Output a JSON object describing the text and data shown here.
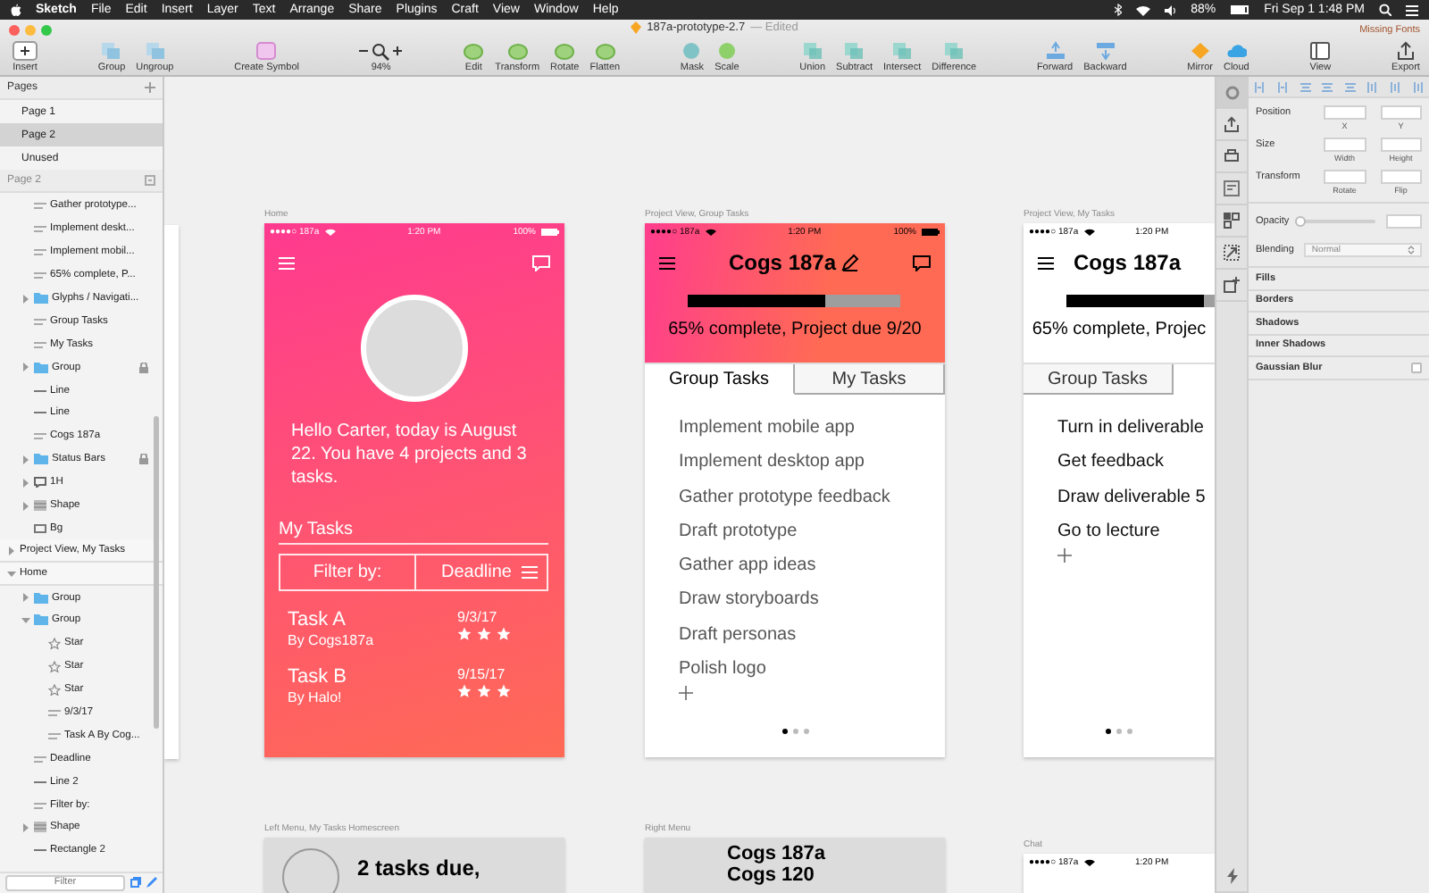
{
  "menubar": {
    "app": "Sketch",
    "menus": [
      "File",
      "Edit",
      "Insert",
      "Layer",
      "Text",
      "Arrange",
      "Share",
      "Plugins",
      "Craft",
      "View",
      "Window",
      "Help"
    ],
    "battery": "88%",
    "clock": "Fri Sep 1 1:48 PM"
  },
  "toolbar": {
    "document": "187a-prototype-2.7",
    "edited": "— Edited",
    "warning": "Missing Fonts",
    "groups": [
      {
        "kind": "insert",
        "tools": [
          "Insert"
        ]
      },
      {
        "kind": "arrange",
        "tools": [
          "Group",
          "Ungroup"
        ]
      },
      {
        "kind": "symbol",
        "tools": [
          "Create Symbol"
        ]
      },
      {
        "kind": "zoom",
        "tools": [
          "94%"
        ]
      },
      {
        "kind": "path",
        "tools": [
          "Edit",
          "Transform",
          "Rotate",
          "Flatten"
        ]
      },
      {
        "kind": "mask",
        "tools": [
          "Mask",
          "Scale"
        ]
      },
      {
        "kind": "boolean",
        "tools": [
          "Union",
          "Subtract",
          "Intersect",
          "Difference"
        ]
      },
      {
        "kind": "layer",
        "tools": [
          "Forward",
          "Backward"
        ]
      },
      {
        "kind": "share",
        "tools": [
          "Mirror",
          "Cloud"
        ]
      },
      {
        "kind": "view",
        "tools": [
          "View"
        ]
      },
      {
        "kind": "export",
        "tools": [
          "Export"
        ]
      }
    ]
  },
  "sidebar": {
    "pages_title": "Pages",
    "pages": [
      {
        "label": "Page 1",
        "selected": false
      },
      {
        "label": "Page 2",
        "selected": true
      },
      {
        "label": "Unused",
        "selected": false
      }
    ],
    "layers_title": "Page 2",
    "layers": [
      {
        "kind": "continued",
        "children": [
          {
            "kind": "text",
            "label": "Gather prototype..."
          },
          {
            "kind": "text",
            "label": "Implement deskt..."
          },
          {
            "kind": "text",
            "label": "Implement mobil..."
          },
          {
            "kind": "text",
            "label": "65% complete, P..."
          },
          {
            "kind": "folder",
            "label": "Glyphs / Navigati...",
            "expanded": false
          },
          {
            "kind": "text",
            "label": "Group Tasks"
          },
          {
            "kind": "text",
            "label": "My Tasks"
          },
          {
            "kind": "folder",
            "label": "Group",
            "expanded": false,
            "locked": true
          },
          {
            "kind": "line",
            "label": "Line"
          },
          {
            "kind": "line",
            "label": "Line"
          },
          {
            "kind": "text",
            "label": "Cogs 187a"
          },
          {
            "kind": "folder",
            "label": "Status Bars",
            "expanded": false,
            "locked": true
          },
          {
            "kind": "comment",
            "label": "1H",
            "expanded": false
          },
          {
            "kind": "shape",
            "label": "Shape",
            "expanded": false
          },
          {
            "kind": "rect",
            "label": "Bg"
          }
        ]
      },
      {
        "kind": "artboard",
        "label": "Project View, My Tasks",
        "expanded": false
      },
      {
        "kind": "artboard",
        "label": "Home",
        "expanded": true,
        "children": [
          {
            "kind": "folder",
            "label": "Group",
            "expanded": false
          },
          {
            "kind": "folder",
            "label": "Group",
            "expanded": true,
            "children": [
              {
                "kind": "star",
                "label": "Star"
              },
              {
                "kind": "star",
                "label": "Star"
              },
              {
                "kind": "star",
                "label": "Star"
              },
              {
                "kind": "text",
                "label": "9/3/17"
              },
              {
                "kind": "text",
                "label": "Task A By Cog..."
              }
            ]
          },
          {
            "kind": "text",
            "label": "Deadline"
          },
          {
            "kind": "line",
            "label": "Line 2"
          },
          {
            "kind": "text",
            "label": "Filter by:"
          },
          {
            "kind": "shape",
            "label": "Shape",
            "expanded": false
          },
          {
            "kind": "line",
            "label": "Rectangle 2"
          }
        ]
      }
    ],
    "filter": {
      "placeholder": "Filter"
    }
  },
  "canvas": {
    "artboards": [
      {
        "kind": "home",
        "label": "Home",
        "status": {
          "carrier": "●●●●○ 187a",
          "time": "1:20 PM",
          "battery": "100%"
        },
        "greeting": "Hello Carter, today is August 22. You have 4 projects and 3 tasks.",
        "section": "My Tasks",
        "filter_label": "Filter by:",
        "filter_value": "Deadline",
        "tasks": [
          {
            "title": "Task A",
            "by": "By Cogs187a",
            "date": "9/3/17",
            "stars": 3
          },
          {
            "title": "Task B",
            "by": "By Halo!",
            "date": "9/15/17",
            "stars": 3
          }
        ]
      },
      {
        "kind": "project",
        "banner": true,
        "label": "Project View, Group Tasks",
        "status": {
          "carrier": "●●●●○ 187a",
          "time": "1:20 PM",
          "battery": "100%"
        },
        "title": "Cogs 187a",
        "progress": {
          "level": 0.65,
          "text": "65% complete, Project due 9/20"
        },
        "tabs": [
          {
            "label": "Group Tasks",
            "selected": true
          },
          {
            "label": "My Tasks",
            "selected": false
          }
        ],
        "items": [
          "Implement mobile app",
          "Implement desktop app",
          "Gather prototype feedback",
          "Draft prototype",
          "Gather app ideas",
          "Draw storyboards",
          "Draft personas",
          "Polish logo"
        ],
        "pages": [
          {
            "selected": true
          },
          {
            "selected": false
          },
          {
            "selected": false
          }
        ]
      },
      {
        "kind": "project",
        "banner": false,
        "label": "Project View, My Tasks",
        "status": {
          "carrier": "●●●●○ 187a",
          "time": "1:20 PM"
        },
        "title": "Cogs 187a",
        "progress": {
          "level": 0.65,
          "text": "65% complete, Projec"
        },
        "tabs": [
          {
            "label": "Group Tasks",
            "selected": false
          },
          {
            "selected": true
          }
        ],
        "items": [
          "Turn in deliverable",
          "Get feedback",
          "Draw deliverable 5",
          "Go to lecture"
        ],
        "pages": [
          {
            "selected": true
          },
          {
            "selected": false
          },
          {
            "selected": false
          }
        ]
      },
      {
        "kind": "profile",
        "label": "Left Menu, My Tasks Homescreen",
        "heading": "2 tasks due,"
      },
      {
        "kind": "menu",
        "label": "Right Menu",
        "lines": [
          "Cogs 187a",
          "Cogs 120"
        ]
      },
      {
        "kind": "chat",
        "label": "Chat",
        "status": {
          "carrier": "●●●●○ 187a",
          "time": "1:20 PM"
        }
      }
    ]
  },
  "inspector": {
    "rows": [
      {
        "label": "Position",
        "captions": [
          "X",
          "Y"
        ]
      },
      {
        "label": "Size",
        "captions": [
          "Width",
          "Height"
        ]
      },
      {
        "label": "Transform",
        "captions": [
          "Rotate",
          "Flip"
        ]
      }
    ],
    "opacity": {
      "label": "Opacity",
      "level": 0
    },
    "blending": {
      "label": "Blending",
      "value": "Normal"
    },
    "sections": [
      {
        "kind": "header",
        "label": "Fills"
      },
      {
        "kind": "header",
        "label": "Borders"
      },
      {
        "kind": "header",
        "label": "Shadows"
      },
      {
        "kind": "header",
        "label": "Inner Shadows"
      },
      {
        "kind": "toggle",
        "label": "Gaussian Blur",
        "checked": false
      }
    ]
  }
}
